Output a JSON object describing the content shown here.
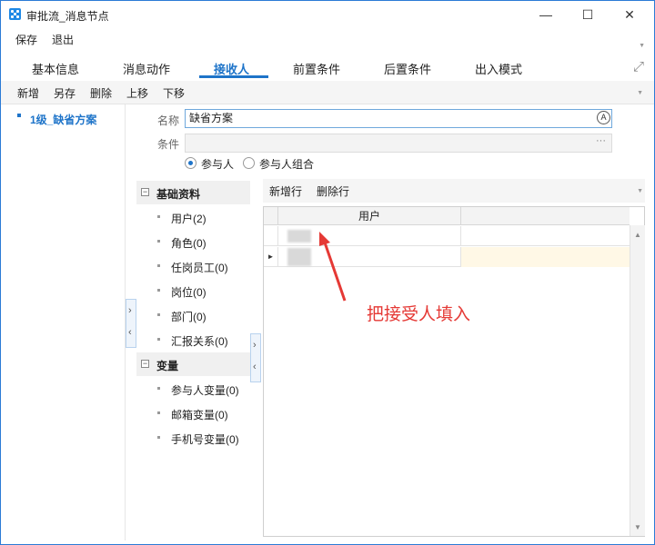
{
  "window": {
    "title": "审批流_消息节点",
    "controls": {
      "minimize": "—",
      "maximize": "☐",
      "close": "✕"
    }
  },
  "menubar": {
    "items": [
      "保存",
      "退出"
    ]
  },
  "tabs": [
    {
      "label": "基本信息",
      "active": false
    },
    {
      "label": "消息动作",
      "active": false
    },
    {
      "label": "接收人",
      "active": true
    },
    {
      "label": "前置条件",
      "active": false
    },
    {
      "label": "后置条件",
      "active": false
    },
    {
      "label": "出入模式",
      "active": false
    }
  ],
  "toolbar": {
    "buttons": [
      "新增",
      "另存",
      "删除",
      "上移",
      "下移"
    ]
  },
  "tree": {
    "items": [
      {
        "label": "1级_缺省方案",
        "selected": true
      }
    ]
  },
  "form": {
    "name_label": "名称",
    "name_value": "缺省方案",
    "condition_label": "条件",
    "condition_value": "",
    "radio_options": [
      {
        "label": "参与人",
        "checked": true
      },
      {
        "label": "参与人组合",
        "checked": false
      }
    ]
  },
  "categories": [
    {
      "title": "基础资料",
      "expanded": true,
      "items": [
        "用户(2)",
        "角色(0)",
        "任岗员工(0)",
        "岗位(0)",
        "部门(0)",
        "汇报关系(0)"
      ]
    },
    {
      "title": "变量",
      "expanded": true,
      "items": [
        "参与人变量(0)",
        "邮箱变量(0)",
        "手机号变量(0)"
      ]
    }
  ],
  "grid": {
    "toolbar": [
      "新增行",
      "删除行"
    ],
    "columns": [
      "用户",
      ""
    ],
    "rows": [
      {
        "current": false,
        "user": "",
        "extra": ""
      },
      {
        "current": true,
        "user": "",
        "extra": ""
      }
    ]
  },
  "annotation": {
    "text": "把接受人填入",
    "color": "#e53935"
  },
  "colors": {
    "accent": "#1e74c9",
    "window_border": "#2b7bd6",
    "annotation": "#e53935"
  }
}
